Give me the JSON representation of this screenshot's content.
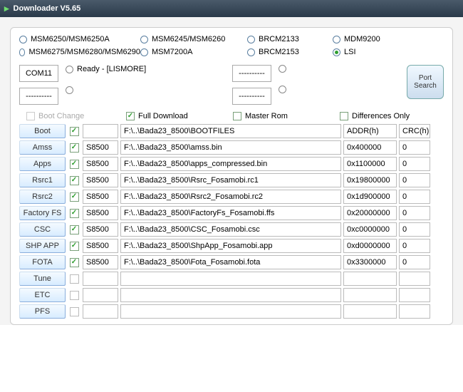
{
  "window": {
    "title": "Downloader V5.65"
  },
  "chipsets": {
    "row1": [
      {
        "label": "MSM6250/MSM6250A",
        "selected": false
      },
      {
        "label": "MSM6245/MSM6260",
        "selected": false
      },
      {
        "label": "BRCM2133",
        "selected": false
      },
      {
        "label": "MDM9200",
        "selected": false
      }
    ],
    "row2": [
      {
        "label": "MSM6275/MSM6280/MSM6290",
        "selected": false
      },
      {
        "label": "MSM7200A",
        "selected": false
      },
      {
        "label": "BRCM2153",
        "selected": false
      },
      {
        "label": "LSI",
        "selected": true
      }
    ]
  },
  "ports": {
    "a_label": "COM11",
    "a_status": "Ready - [LISMORE]",
    "b_label": "----------",
    "b_status": "",
    "c_label": "----------",
    "c_status": "",
    "d_label": "----------",
    "d_status": "",
    "search_btn_line1": "Port",
    "search_btn_line2": "Search"
  },
  "options": {
    "boot_change": "Boot Change",
    "full_download": "Full Download",
    "master_rom": "Master Rom",
    "differences_only": "Differences Only"
  },
  "headers": {
    "addr": "ADDR(h)",
    "crc": "CRC(h)"
  },
  "rows": [
    {
      "name": "Boot",
      "checked": true,
      "model": "",
      "path": "F:\\..\\Bada23_8500\\BOOTFILES",
      "addr": "",
      "crc": ""
    },
    {
      "name": "Amss",
      "checked": true,
      "model": "S8500",
      "path": "F:\\..\\Bada23_8500\\amss.bin",
      "addr": "0x400000",
      "crc": "0"
    },
    {
      "name": "Apps",
      "checked": true,
      "model": "S8500",
      "path": "F:\\..\\Bada23_8500\\apps_compressed.bin",
      "addr": "0x1100000",
      "crc": "0"
    },
    {
      "name": "Rsrc1",
      "checked": true,
      "model": "S8500",
      "path": "F:\\..\\Bada23_8500\\Rsrc_Fosamobi.rc1",
      "addr": "0x19800000",
      "crc": "0"
    },
    {
      "name": "Rsrc2",
      "checked": true,
      "model": "S8500",
      "path": "F:\\..\\Bada23_8500\\Rsrc2_Fosamobi.rc2",
      "addr": "0x1d900000",
      "crc": "0"
    },
    {
      "name": "Factory FS",
      "checked": true,
      "model": "S8500",
      "path": "F:\\..\\Bada23_8500\\FactoryFs_Fosamobi.ffs",
      "addr": "0x20000000",
      "crc": "0"
    },
    {
      "name": "CSC",
      "checked": true,
      "model": "S8500",
      "path": "F:\\..\\Bada23_8500\\CSC_Fosamobi.csc",
      "addr": "0xc0000000",
      "crc": "0"
    },
    {
      "name": "SHP APP",
      "checked": true,
      "model": "S8500",
      "path": "F:\\..\\Bada23_8500\\ShpApp_Fosamobi.app",
      "addr": "0xd0000000",
      "crc": "0"
    },
    {
      "name": "FOTA",
      "checked": true,
      "model": "S8500",
      "path": "F:\\..\\Bada23_8500\\Fota_Fosamobi.fota",
      "addr": "0x3300000",
      "crc": "0"
    },
    {
      "name": "Tune",
      "checked": false,
      "model": "",
      "path": "",
      "addr": "",
      "crc": ""
    },
    {
      "name": "ETC",
      "checked": false,
      "model": "",
      "path": "",
      "addr": "",
      "crc": ""
    },
    {
      "name": "PFS",
      "checked": false,
      "model": "",
      "path": "",
      "addr": "",
      "crc": ""
    }
  ]
}
